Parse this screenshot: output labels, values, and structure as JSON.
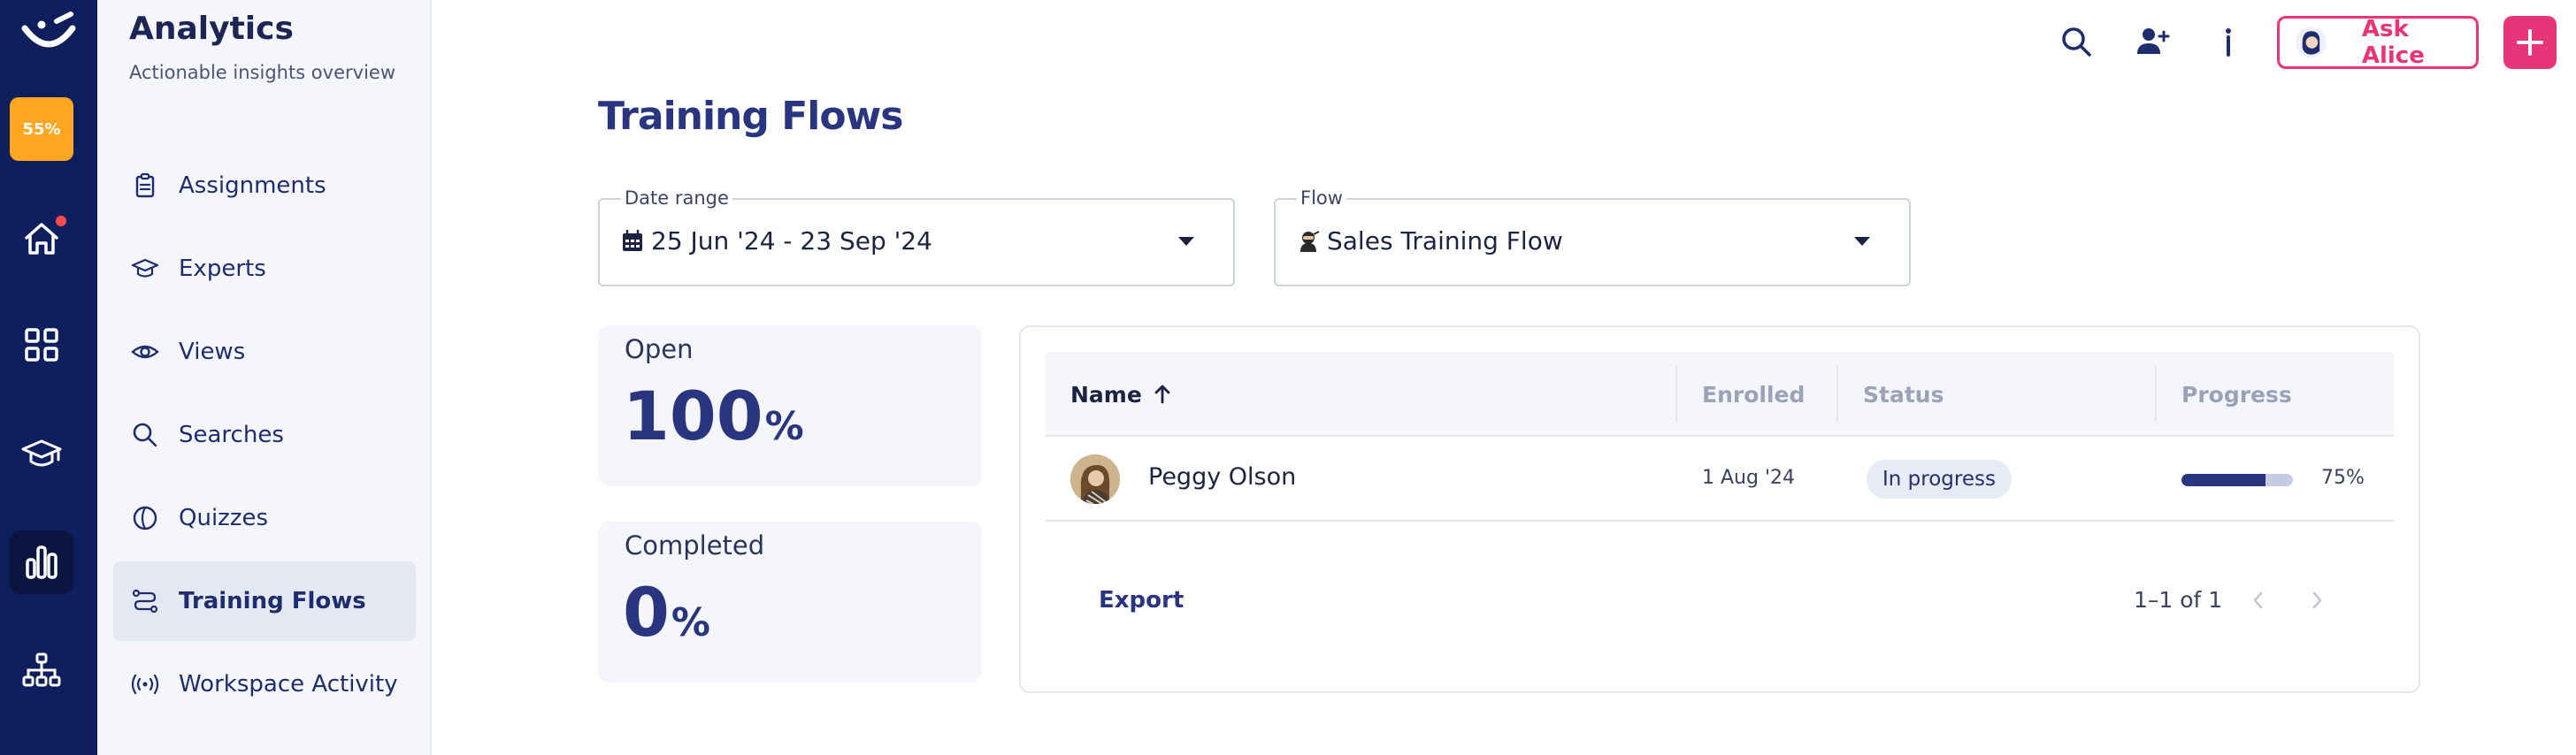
{
  "rail": {
    "progress": "55%",
    "items": [
      "home-icon",
      "apps-icon",
      "graduation-cap-icon",
      "analytics-icon",
      "org-chart-icon"
    ]
  },
  "sidebar": {
    "title": "Analytics",
    "subtitle": "Actionable insights overview",
    "items": [
      {
        "label": "Assignments",
        "icon": "clipboard-icon"
      },
      {
        "label": "Experts",
        "icon": "graduation-cap-icon"
      },
      {
        "label": "Views",
        "icon": "eye-icon"
      },
      {
        "label": "Searches",
        "icon": "search-icon"
      },
      {
        "label": "Quizzes",
        "icon": "quiz-icon"
      },
      {
        "label": "Training Flows",
        "icon": "flow-icon",
        "active": true
      },
      {
        "label": "Workspace Activity",
        "icon": "broadcast-icon"
      }
    ]
  },
  "topbar": {
    "ask_label": "Ask Alice"
  },
  "page": {
    "title": "Training Flows"
  },
  "filters": {
    "date_range": {
      "label": "Date range",
      "value": "25 Jun '24 - 23 Sep '24"
    },
    "flow": {
      "label": "Flow",
      "value": "Sales Training Flow"
    }
  },
  "stats": {
    "open": {
      "label": "Open",
      "value": "100",
      "unit": "%"
    },
    "completed": {
      "label": "Completed",
      "value": "0",
      "unit": "%"
    }
  },
  "table": {
    "columns": {
      "name": "Name",
      "enrolled": "Enrolled",
      "status": "Status",
      "progress": "Progress"
    },
    "rows": [
      {
        "name": "Peggy Olson",
        "enrolled": "1 Aug '24",
        "status": "In progress",
        "progress": 0.75,
        "progress_label": "75%"
      }
    ],
    "export_label": "Export",
    "pagination": "1–1 of 1"
  },
  "colors": {
    "rail": "#0f1e5c",
    "accent": "#2a3580",
    "brand_pink": "#e8357a",
    "progress_orange": "#ffa51f"
  }
}
